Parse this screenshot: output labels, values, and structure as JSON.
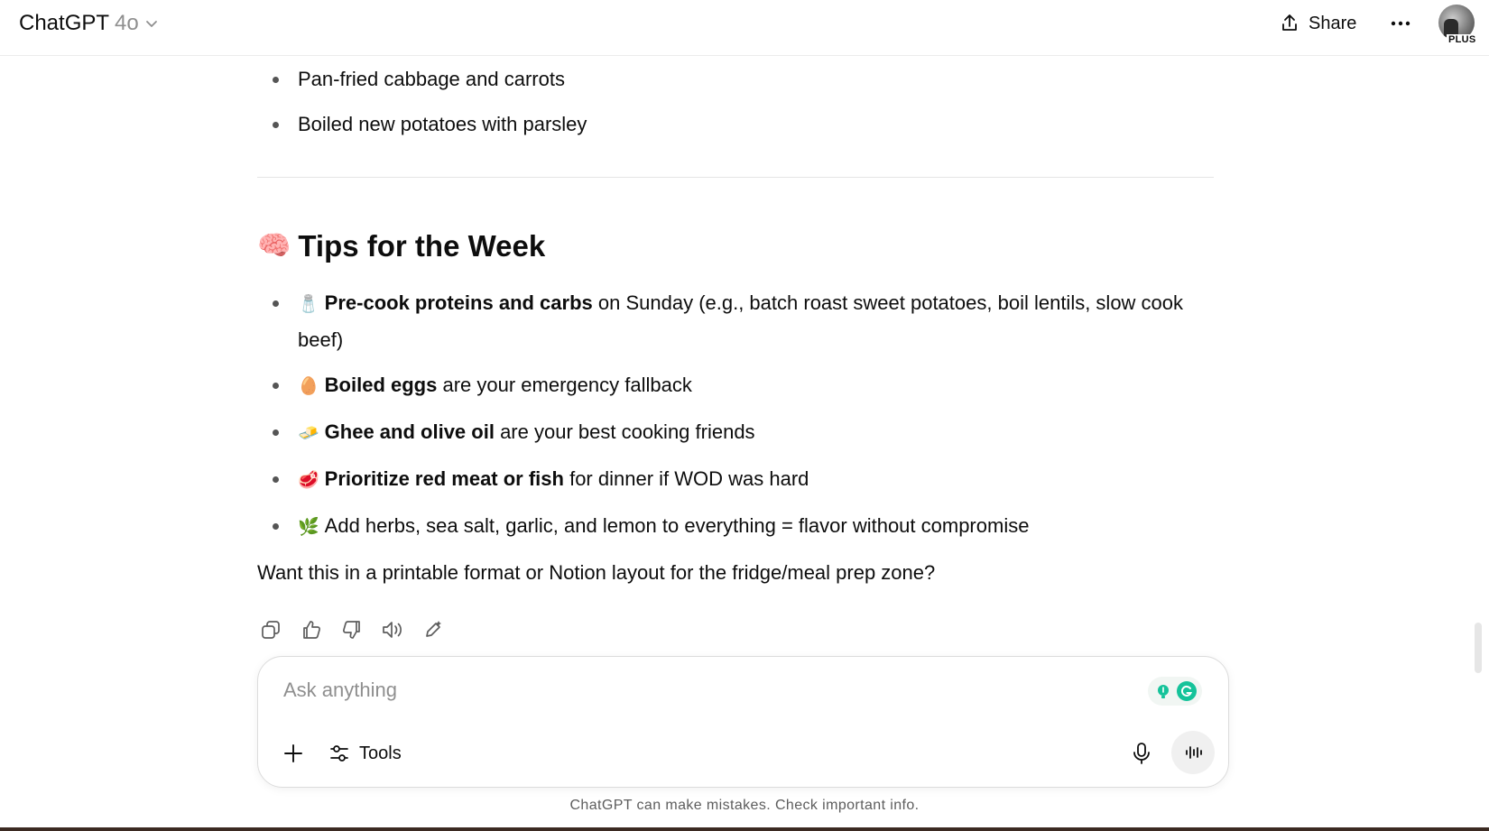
{
  "header": {
    "model_name": "ChatGPT",
    "model_version": "4o",
    "share_label": "Share",
    "plan_badge": "PLUS"
  },
  "previous_list": [
    "Pan-fried cabbage and carrots",
    "Boiled new potatoes with parsley"
  ],
  "section": {
    "emoji": "🧠",
    "title": "Tips for the Week"
  },
  "tips": [
    {
      "emoji": "🧂",
      "bold": "Pre-cook proteins and carbs",
      "rest": " on Sunday (e.g., batch roast sweet potatoes, boil lentils, slow cook beef)"
    },
    {
      "emoji": "🥚",
      "bold": "Boiled eggs",
      "rest": " are your emergency fallback"
    },
    {
      "emoji": "🧈",
      "bold": "Ghee and olive oil",
      "rest": " are your best cooking friends"
    },
    {
      "emoji": "🥩",
      "bold": "Prioritize red meat or fish",
      "rest": " for dinner if WOD was hard"
    },
    {
      "emoji": "🌿",
      "bold": "",
      "rest": "Add herbs, sea salt, garlic, and lemon to everything = flavor without compromise"
    }
  ],
  "followup": "Want this in a printable format or Notion layout for the fridge/meal prep zone?",
  "actions": [
    "copy-icon",
    "thumbs-up-icon",
    "thumbs-down-icon",
    "read-aloud-icon",
    "edit-icon"
  ],
  "composer": {
    "placeholder": "Ask anything",
    "tools_label": "Tools"
  },
  "disclaimer": "ChatGPT can make mistakes. Check important info.",
  "colors": {
    "text": "#0d0d0d",
    "muted": "#8f8f8f",
    "grammarly": "#15c39a"
  }
}
